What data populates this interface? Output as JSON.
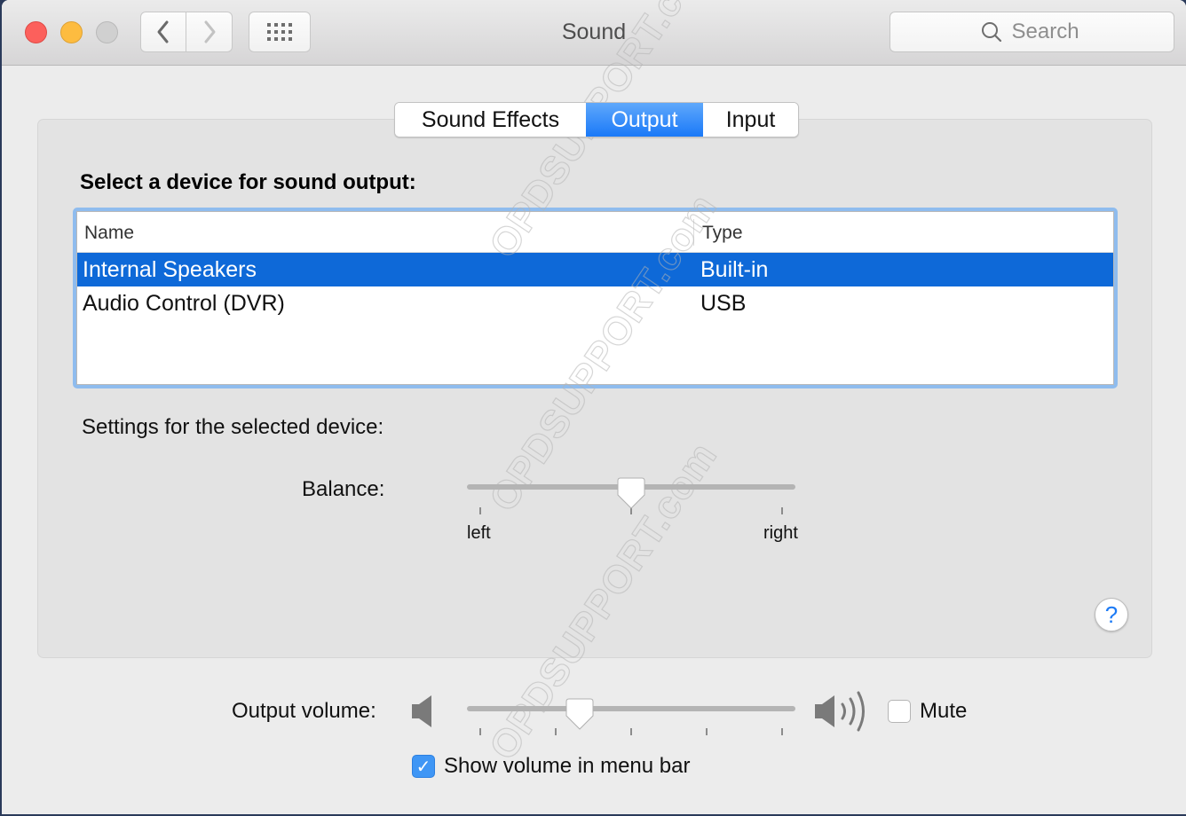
{
  "window": {
    "title": "Sound",
    "traffic_lights": [
      "close",
      "minimize",
      "zoom-disabled"
    ],
    "nav": {
      "back_icon": "chevron-left-icon",
      "forward_icon": "chevron-right-icon",
      "grid_icon": "show-all-grid-icon"
    },
    "search": {
      "placeholder": "Search",
      "value": ""
    }
  },
  "tabs": [
    {
      "label": "Sound Effects",
      "selected": false
    },
    {
      "label": "Output",
      "selected": true
    },
    {
      "label": "Input",
      "selected": false
    }
  ],
  "device_section": {
    "heading": "Select a device for sound output:",
    "columns": [
      "Name",
      "Type"
    ],
    "rows": [
      {
        "name": "Internal Speakers",
        "type": "Built-in",
        "selected": true
      },
      {
        "name": "Audio Control (DVR)",
        "type": "USB",
        "selected": false
      }
    ]
  },
  "settings": {
    "label": "Settings for the selected device:",
    "balance": {
      "label": "Balance:",
      "min_label": "left",
      "max_label": "right",
      "value": 0.5
    }
  },
  "help_button": {
    "glyph": "?"
  },
  "output_volume": {
    "label": "Output volume:",
    "value": 0.33,
    "low_icon": "speaker-low-icon",
    "high_icon": "speaker-high-icon",
    "mute": {
      "label": "Mute",
      "checked": false
    }
  },
  "show_in_menu_bar": {
    "label": "Show volume in menu bar",
    "checked": true
  },
  "colors": {
    "accent": "#1a79f8",
    "selection": "#0e69d8",
    "focus_ring": "#8fbcee",
    "help_glyph": "#1c7af5"
  },
  "watermark": "OPDSUPPORT.com"
}
